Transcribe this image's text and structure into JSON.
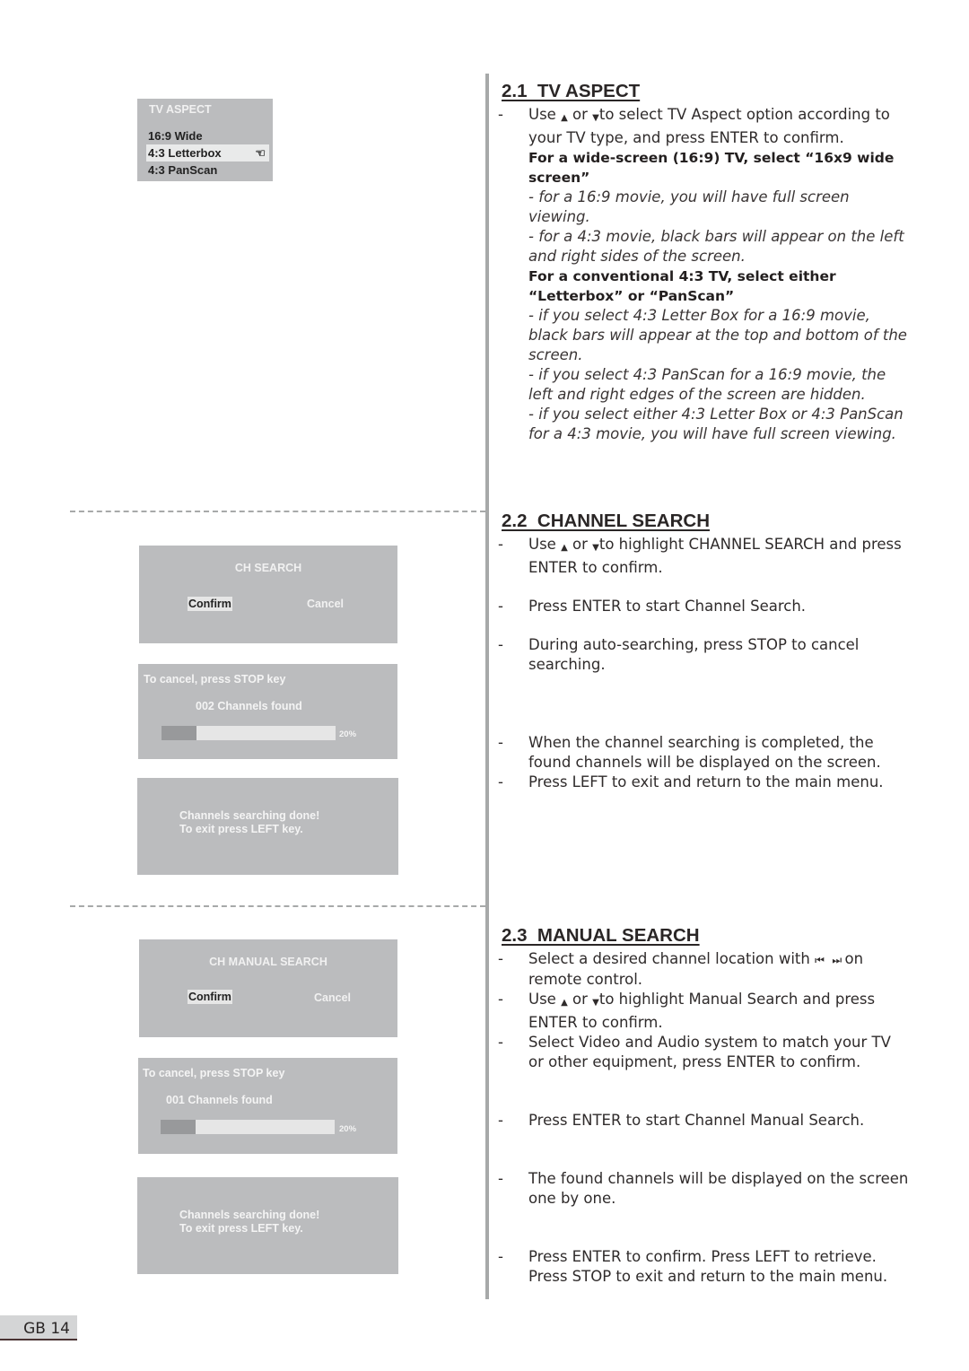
{
  "page": {
    "number_label": "GB 14"
  },
  "osd": {
    "tv_aspect": {
      "title": "TV ASPECT",
      "options": [
        "16:9 Wide",
        "4:3 Letterbox",
        "4:3 PanScan"
      ],
      "selected": "4:3 Letterbox",
      "pointer_icon": "hand-pointer-icon"
    },
    "ch_search": {
      "title": "CH SEARCH",
      "confirm": "Confirm",
      "cancel": "Cancel"
    },
    "ch_search_progress": {
      "cancel_hint": "To cancel, press STOP key",
      "found": "002 Channels found",
      "progress_percent": 20,
      "progress_label": "20%"
    },
    "ch_search_done": {
      "line1": "Channels searching done!",
      "line2": "To exit press LEFT key."
    },
    "manual_search": {
      "title": "CH MANUAL SEARCH",
      "confirm": "Confirm",
      "cancel": "Cancel"
    },
    "manual_progress": {
      "cancel_hint": "To cancel, press STOP key",
      "found": "001 Channels found",
      "progress_percent": 20,
      "progress_label": "20%"
    },
    "manual_done": {
      "line1": "Channels searching done!",
      "line2": "To exit press LEFT key."
    }
  },
  "sections": {
    "tv_aspect": {
      "heading": "2.1  TV ASPECT",
      "b1_pre": "Use ",
      "up": "▲",
      "or": " or ",
      "down": "▼",
      "b1_post": "to select TV Aspect option according to your TV type, and press ENTER to confirm.",
      "wide_bold": "For a wide-screen (16:9) TV, select “16x9 wide screen”",
      "wide_i1": "- for a 16:9 movie, you will have full screen viewing.",
      "wide_i2": "- for a 4:3 movie, black bars will appear on the left and right sides of the screen.",
      "conv_bold": "For a conventional 4:3 TV, select either “Letterbox” or “PanScan”",
      "conv_i1": "- if you select 4:3 Letter Box for a 16:9 movie, black bars will appear at the top and bottom of the screen.",
      "conv_i2": "- if you select 4:3 PanScan for a 16:9 movie, the left and right edges of the screen are hidden.",
      "conv_i3": "- if you select either 4:3 Letter Box or 4:3 PanScan for a 4:3 movie, you will have full screen viewing."
    },
    "channel_search": {
      "heading": "2.2  CHANNEL SEARCH",
      "b1_pre": "Use ",
      "b1_post": "to highlight CHANNEL SEARCH and press ENTER to confirm.",
      "b2": "Press ENTER to start Channel Search.",
      "b3": "During auto-searching, press STOP to cancel searching.",
      "b4": "When the channel searching is completed, the found channels will be displayed on the screen.",
      "b5": "Press LEFT to exit and return to the main menu."
    },
    "manual_search": {
      "heading": "2.3  MANUAL SEARCH",
      "b1_pre": "Select a desired channel location with ",
      "prev": "⏮",
      "next": "⏭",
      "b1_post": " on remote control.",
      "b2_pre": "Use ",
      "b2_post": "to highlight Manual Search and press ENTER to confirm.",
      "b3": "Select Video and Audio system to match your TV or other equipment, press ENTER to confirm.",
      "b4": "Press ENTER to start Channel Manual Search.",
      "b5": "The found channels will be displayed on the screen one by one.",
      "b6": "Press ENTER to confirm. Press LEFT to retrieve. Press STOP to exit and return to the main menu."
    },
    "dash": "-"
  }
}
